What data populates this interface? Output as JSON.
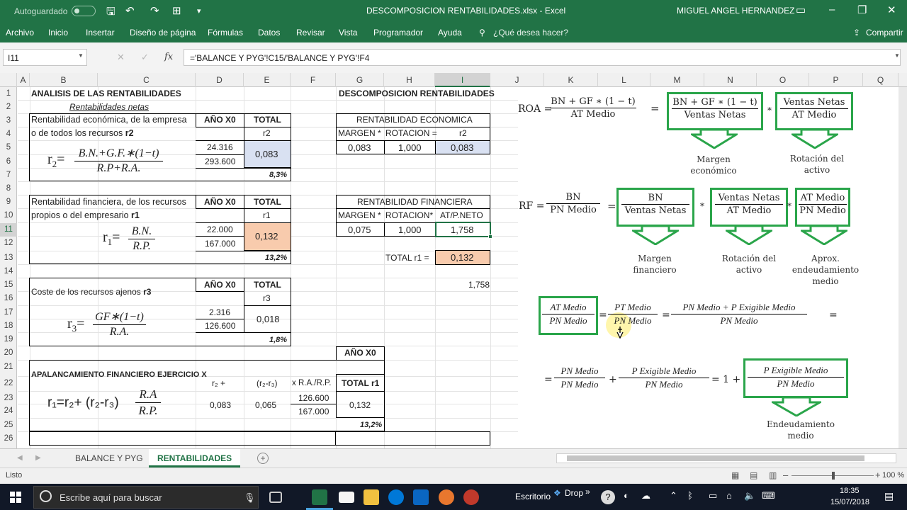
{
  "titlebar": {
    "autosave": "Autoguardado",
    "document": "DESCOMPOSICION RENTABILIDADES.xlsx - Excel",
    "user": "MIGUEL ANGEL HERNANDEZ"
  },
  "ribbon": {
    "tabs": [
      "Archivo",
      "Inicio",
      "Insertar",
      "Diseño de página",
      "Fórmulas",
      "Datos",
      "Revisar",
      "Vista",
      "Programador",
      "Ayuda"
    ],
    "tell_me": "¿Qué desea hacer?",
    "share": "Compartir"
  },
  "formula_bar": {
    "name_box": "I11",
    "formula": "='BALANCE Y PYG'!C15/'BALANCE Y PYG'!F4"
  },
  "columns": [
    "A",
    "B",
    "C",
    "D",
    "E",
    "F",
    "G",
    "H",
    "I",
    "J",
    "K",
    "L",
    "M",
    "N",
    "O",
    "P",
    "Q"
  ],
  "rows": [
    "1",
    "2",
    "3",
    "4",
    "5",
    "6",
    "7",
    "8",
    "9",
    "10",
    "11",
    "12",
    "13",
    "14",
    "15",
    "16",
    "17",
    "18",
    "19",
    "20",
    "21",
    "22",
    "23",
    "24",
    "25",
    "26"
  ],
  "cells": {
    "b1": "ANALISIS DE LAS RENTABILIDADES",
    "g1": "DESCOMPOSICION RENTABILIDADES",
    "b2": "Rentabilidades netas",
    "b3": "Rentabilidad económica, de la empresa",
    "b4a": "o de todos los recursos ",
    "b4b": "r2",
    "d3": "AÑO X0",
    "e3": "TOTAL",
    "e4": "r2",
    "d5": "24.316",
    "d6": "293.600",
    "e5": "0,083",
    "e7": "8,3%",
    "g3": "RENTABILIDAD ECONOMICA",
    "g4": "MARGEN *",
    "h4": "ROTACION =",
    "i4": "r2",
    "g5": "0,083",
    "h5": "1,000",
    "i5": "0,083",
    "b9": "Rentabilidad financiera, de los recursos",
    "b10a": "propios  o del empresario  ",
    "b10b": "r1",
    "d9": "AÑO X0",
    "e9": "TOTAL",
    "e10": "r1",
    "d11": "22.000",
    "d12": "167.000",
    "e11": "0,132",
    "e13": "13,2%",
    "g9": "RENTABILIDAD FINANCIERA",
    "g10": "MARGEN *",
    "h10": "ROTACION*",
    "i10": "AT/P.NETO",
    "g11": "0,075",
    "h11": "1,000",
    "i11": "1,758",
    "h13": "TOTAL r1 =",
    "i13": "0,132",
    "i15": "1,758",
    "b15a": "Coste de los recursos ajenos ",
    "b15b": "r3",
    "d15": "AÑO X0",
    "e15": "TOTAL",
    "e16": "r3",
    "d17": "2.316",
    "d18": "126.600",
    "e17": "0,018",
    "e19": "1,8%",
    "g20": "AÑO X0",
    "b22": "APALANCAMIENTO FINANCIERO EJERCICIO X",
    "d22": "r₂ +",
    "e22": "(r₂-r₃)",
    "f22": "x R.A./R.P.",
    "g22": "TOTAL r1",
    "f23": "126.600",
    "f24": "167.000",
    "d23": "0,083",
    "e23": "0,065",
    "g23": "0,132",
    "g25": "13,2%"
  },
  "formulas": {
    "r2_lhs": "r",
    "r2_sub": "2",
    "r2_num": "B.N.+G.F.∗(1−t)",
    "r2_den": "R.P+R.A.",
    "r1_lhs": "r",
    "r1_sub": "1",
    "r1_num": "B.N.",
    "r1_den": "R.P.",
    "r3_lhs": "r",
    "r3_sub": "3",
    "r3_num": "GF∗(1−t)",
    "r3_den": "R.A.",
    "apal_text": "r₁=r₂+ (r₂-r₃)",
    "apal_num": "R.A",
    "apal_den": "R.P."
  },
  "diagram": {
    "roa_label": "ROA =",
    "roa_num": "BN + GF ∗ (1 − t)",
    "roa_den": "AT Medio",
    "eq": "=",
    "times": "*",
    "roa_box1_num": "BN + GF ∗ (1 − t)",
    "roa_box1_den": "Ventas Netas",
    "roa_box2_num": "Ventas Netas",
    "roa_box2_den": "AT Medio",
    "roa_caption1": "Margen económico",
    "roa_caption2": "Rotación del activo",
    "rf_label": "RF =",
    "rf_num": "BN",
    "rf_den": "PN Medio",
    "rf_box1_num": "BN",
    "rf_box1_den": "Ventas Netas",
    "rf_box2_num": "Ventas Netas",
    "rf_box2_den": "AT Medio",
    "rf_box3_num": "AT Medio",
    "rf_box3_den": "PN Medio",
    "rf_caption1": "Margen financiero",
    "rf_caption2": "Rotación del activo",
    "rf_caption3": "Aprox. endeudamiento medio",
    "lev_box_num": "AT Medio",
    "lev_box_den": "PN Medio",
    "lev_f2_num": "PT Medio",
    "lev_f2_den": "PN Medio",
    "lev_f3_num": "PN Medio + P Exigible Medio",
    "lev_f3_den": "PN Medio",
    "lev2_f1_num": "PN Medio",
    "lev2_f1_den": "PN Medio",
    "plus": "+",
    "lev2_f2_num": "P Exigible Medio",
    "lev2_f2_den": "PN Medio",
    "lev2_one": "= 1 +",
    "lev2_box_num": "P Exigible Medio",
    "lev2_box_den": "PN Medio",
    "lev2_caption": "Endeudamiento medio"
  },
  "sheet_tabs": [
    "BALANCE Y PYG",
    "RENTABILIDADES"
  ],
  "status": {
    "ready": "Listo",
    "zoom": "100 %"
  },
  "taskbar": {
    "search_placeholder": "Escribe aquí para buscar",
    "desktop": "Escritorio",
    "drop": "Drop",
    "time": "18:35",
    "date": "15/07/2018"
  },
  "colors": {
    "excel_green": "#217346",
    "diagram_green": "#2aa54a",
    "cell_blue": "#d9e1f2",
    "cell_orange": "#f8cbad"
  }
}
